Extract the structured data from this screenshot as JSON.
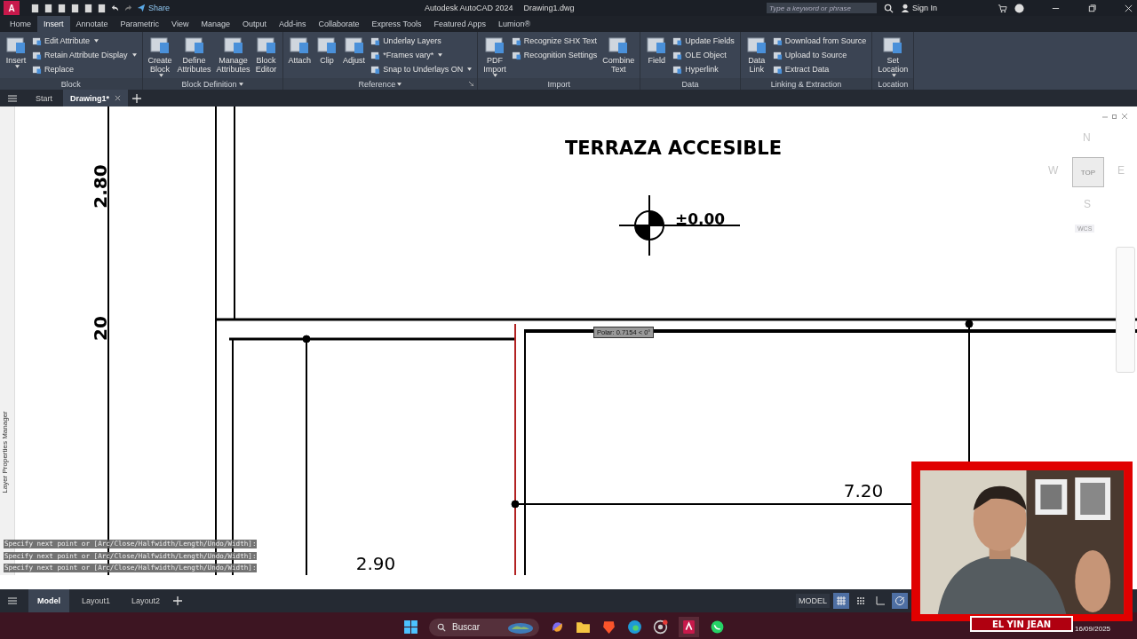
{
  "title_bar": {
    "app_logo": "A",
    "share": "Share",
    "title": "Autodesk AutoCAD 2024",
    "file_name": "Drawing1.dwg",
    "search": {
      "placeholder": "Type a keyword or phrase"
    },
    "sign_in": "Sign In"
  },
  "ribbon_tabs": [
    {
      "label": "Home",
      "selected": false
    },
    {
      "label": "Insert",
      "selected": true
    },
    {
      "label": "Annotate",
      "selected": false
    },
    {
      "label": "Parametric",
      "selected": false
    },
    {
      "label": "View",
      "selected": false
    },
    {
      "label": "Manage",
      "selected": false
    },
    {
      "label": "Output",
      "selected": false
    },
    {
      "label": "Add-ins",
      "selected": false
    },
    {
      "label": "Collaborate",
      "selected": false
    },
    {
      "label": "Express Tools",
      "selected": false
    },
    {
      "label": "Featured Apps",
      "selected": false
    },
    {
      "label": "Lumion®",
      "selected": false
    }
  ],
  "ribbon_panels": [
    {
      "title": "Block",
      "title_menu": false,
      "launcher": false,
      "groups": [
        {
          "kind": "large",
          "label": "Insert",
          "dropdown": true
        },
        {
          "kind": "stack",
          "items": [
            {
              "label": "Edit Attribute",
              "dropdown": true
            },
            {
              "label": "Retain Attribute Display",
              "dropdown": true
            },
            {
              "label": "Replace",
              "dropdown": false
            }
          ]
        }
      ]
    },
    {
      "title": "Block Definition",
      "title_menu": true,
      "launcher": false,
      "groups": [
        {
          "kind": "large",
          "label": "Create Block",
          "dropdown": true
        },
        {
          "kind": "large",
          "label": "Define Attributes",
          "dropdown": false
        },
        {
          "kind": "large",
          "label": "Manage Attributes",
          "dropdown": false
        },
        {
          "kind": "large",
          "label": "Block Editor",
          "dropdown": false
        }
      ]
    },
    {
      "title": "Reference",
      "title_menu": true,
      "launcher": true,
      "groups": [
        {
          "kind": "large",
          "label": "Attach",
          "dropdown": false
        },
        {
          "kind": "large",
          "label": "Clip",
          "dropdown": false
        },
        {
          "kind": "large",
          "label": "Adjust",
          "dropdown": false
        },
        {
          "kind": "stack",
          "items": [
            {
              "label": "Underlay Layers",
              "dropdown": false
            },
            {
              "label": "*Frames vary*",
              "dropdown": true
            },
            {
              "label": "Snap to Underlays ON",
              "dropdown": true
            }
          ]
        }
      ]
    },
    {
      "title": "Import",
      "title_menu": false,
      "launcher": false,
      "groups": [
        {
          "kind": "large",
          "label": "PDF Import",
          "dropdown": true
        },
        {
          "kind": "stack",
          "items": [
            {
              "label": "Recognize SHX Text",
              "dropdown": false
            },
            {
              "label": "Recognition Settings",
              "dropdown": false
            }
          ]
        },
        {
          "kind": "large",
          "label": "Combine Text",
          "dropdown": false
        }
      ]
    },
    {
      "title": "Data",
      "title_menu": false,
      "launcher": false,
      "groups": [
        {
          "kind": "large",
          "label": "Field",
          "dropdown": false
        },
        {
          "kind": "stack",
          "items": [
            {
              "label": "Update Fields",
              "dropdown": false
            },
            {
              "label": "OLE Object",
              "dropdown": false
            },
            {
              "label": "Hyperlink",
              "dropdown": false
            }
          ]
        }
      ]
    },
    {
      "title": "Linking & Extraction",
      "title_menu": false,
      "launcher": false,
      "groups": [
        {
          "kind": "large",
          "label": "Data Link",
          "dropdown": false
        },
        {
          "kind": "stack",
          "items": [
            {
              "label": "Download from Source",
              "dropdown": false
            },
            {
              "label": "Upload to Source",
              "dropdown": false
            },
            {
              "label": "Extract  Data",
              "dropdown": false
            }
          ]
        }
      ]
    },
    {
      "title": "Location",
      "title_menu": false,
      "launcher": false,
      "groups": [
        {
          "kind": "large",
          "label": "Set Location",
          "dropdown": true
        }
      ]
    }
  ],
  "file_tabs": [
    {
      "label": "Start",
      "selected": false,
      "closable": false
    },
    {
      "label": "Drawing1*",
      "selected": true,
      "closable": true
    }
  ],
  "side_palette": "Layer Properties Manager",
  "drawing_texts": [
    {
      "kind": "title",
      "text": "TERRAZA ACCESIBLE"
    },
    {
      "kind": "level",
      "text": "±0.00"
    },
    {
      "kind": "vertical",
      "text": "2.80"
    },
    {
      "kind": "vertical",
      "text": "20"
    },
    {
      "kind": "dimension",
      "text": "7.20"
    },
    {
      "kind": "dimension",
      "text": "2.90"
    }
  ],
  "view_cube": {
    "north": "N",
    "west": "W",
    "face": "TOP",
    "east": "E",
    "south": "S",
    "coordinate_system": "WCS"
  },
  "tooltip": "Polar: 0.7154 < 0°",
  "command_history": [
    "Specify next point or [Arc/Close/Halfwidth/Length/Undo/Width]:",
    "Specify next point or [Arc/Close/Halfwidth/Length/Undo/Width]:",
    "Specify next point or [Arc/Close/Halfwidth/Length/Undo/Width]:"
  ],
  "layout_tabs": [
    {
      "label": "Model",
      "selected": true
    },
    {
      "label": "Layout1",
      "selected": false
    },
    {
      "label": "Layout2",
      "selected": false
    }
  ],
  "status_bar": {
    "space": "MODEL",
    "toggles": [
      {
        "kind": "grid",
        "on": true
      },
      {
        "kind": "snap",
        "on": false
      },
      {
        "kind": "ortho",
        "on": false
      },
      {
        "kind": "polar",
        "on": true
      }
    ]
  },
  "taskbar": {
    "search": {
      "placeholder": "Buscar"
    },
    "date": "16/09/2025"
  },
  "webcam": {
    "kind": "picture",
    "caption": "EL YIN JEAN"
  }
}
